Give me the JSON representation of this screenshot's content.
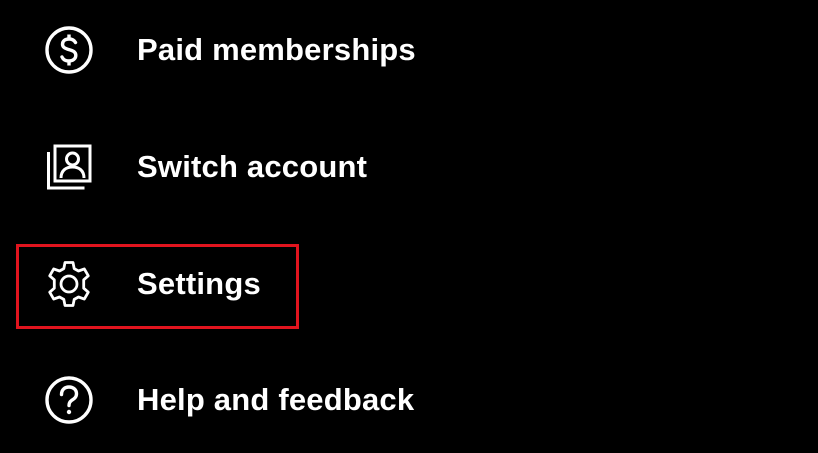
{
  "menu": {
    "items": [
      {
        "label": "Paid memberships",
        "icon": "dollar-circle-icon"
      },
      {
        "label": "Switch account",
        "icon": "switch-account-icon"
      },
      {
        "label": "Settings",
        "icon": "gear-icon"
      },
      {
        "label": "Help and feedback",
        "icon": "help-circle-icon"
      }
    ]
  },
  "highlight": {
    "target": "Settings",
    "color": "#e0141e"
  },
  "colors": {
    "background": "#000000",
    "text": "#ffffff"
  }
}
